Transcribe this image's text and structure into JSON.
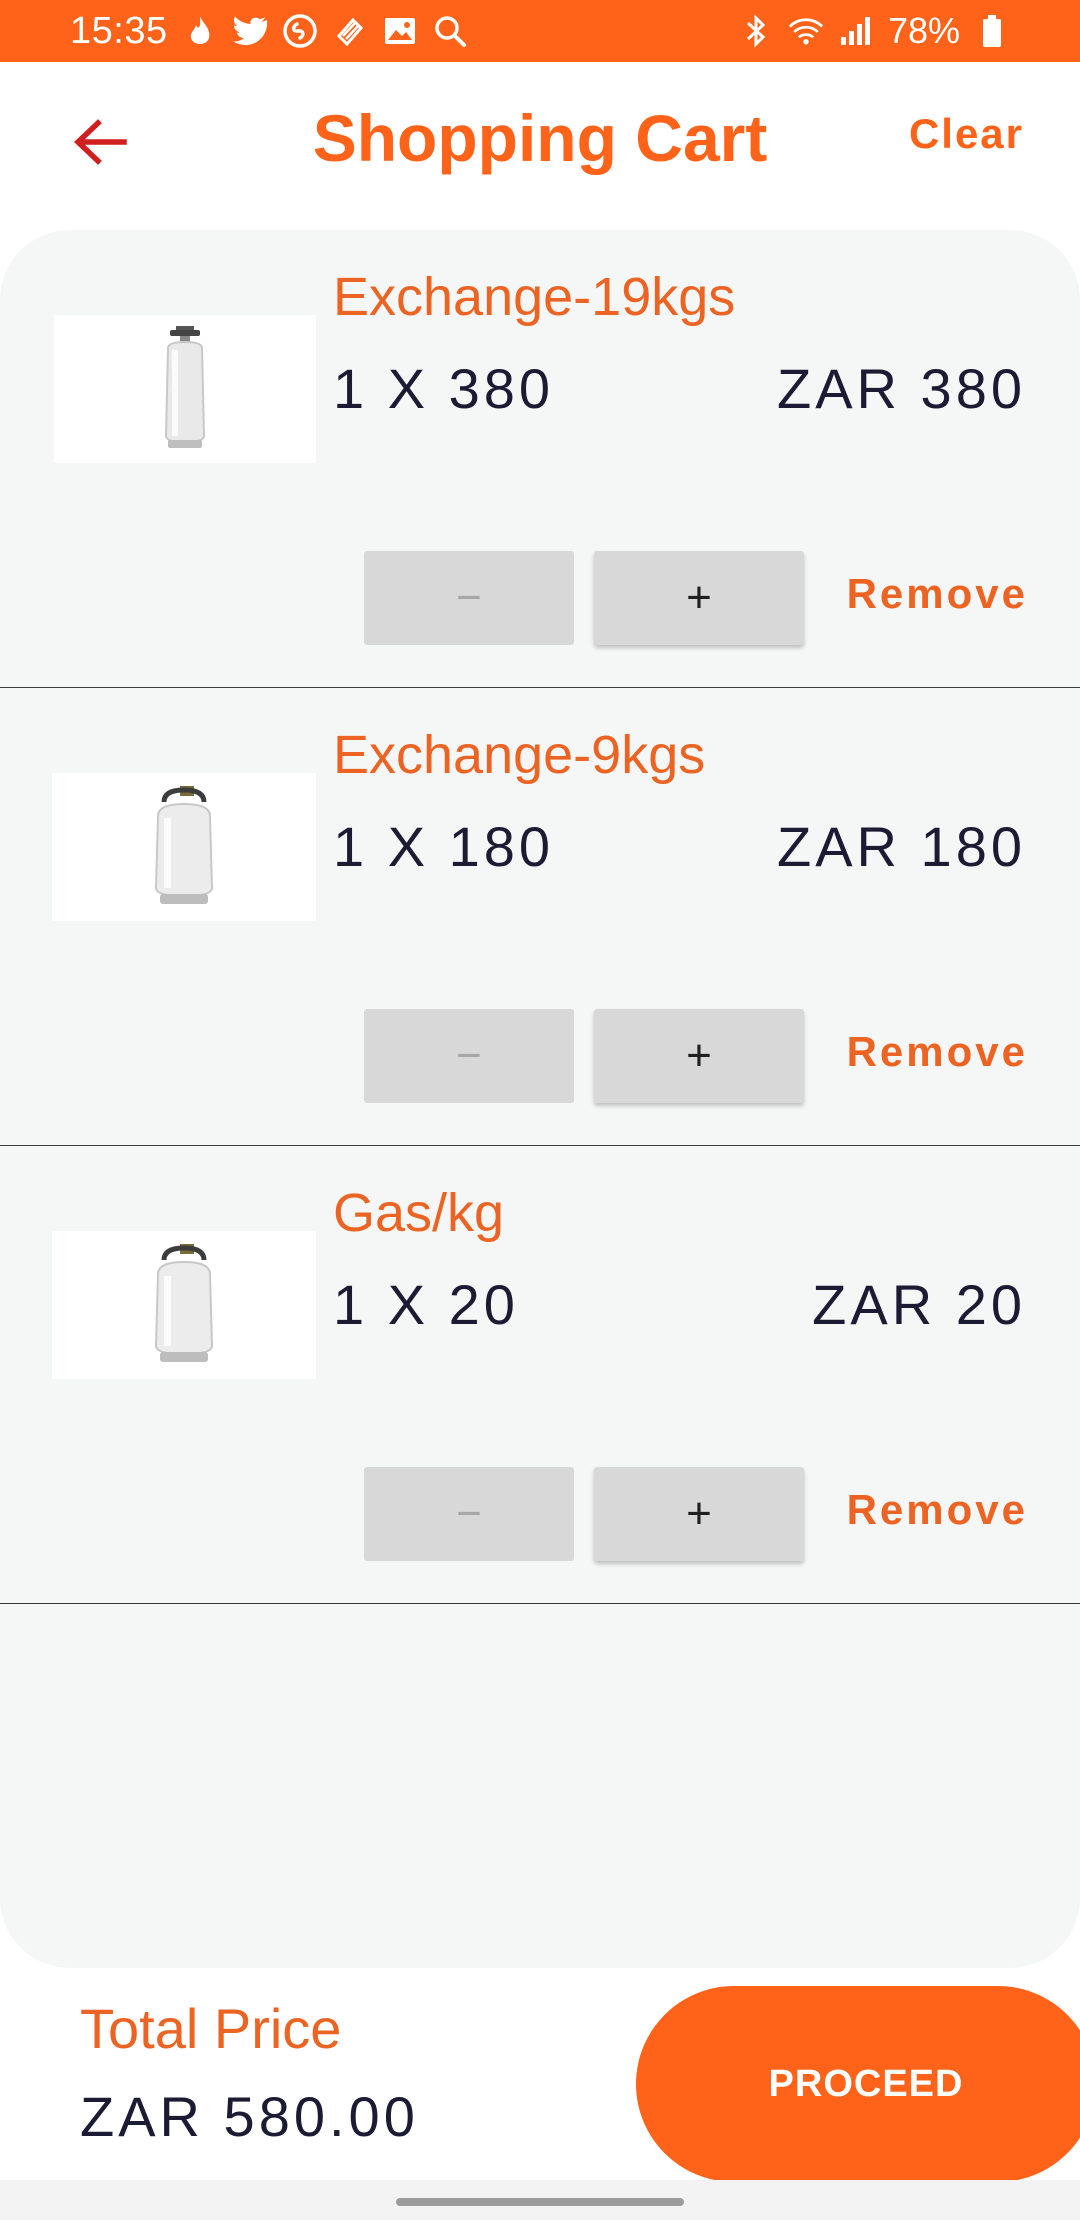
{
  "status_bar": {
    "time": "15:35",
    "battery": "78%",
    "left_icons": [
      "flame-icon",
      "twitter-icon",
      "shazam-icon",
      "pay-icon",
      "gallery-icon",
      "search-icon"
    ],
    "right_icons": [
      "bluetooth-icon",
      "wifi-icon",
      "signal-icon",
      "battery-icon"
    ],
    "background": "#ff6319"
  },
  "header": {
    "title": "Shopping Cart",
    "clear_label": "Clear",
    "back_icon": "arrow-left-icon",
    "accent": "#ff6319",
    "back_color": "#d11f1f"
  },
  "cart": {
    "items": [
      {
        "name": "Exchange-19kgs",
        "quantity_line": "1 X 380",
        "line_total": "ZAR 380",
        "minus_label": "−",
        "plus_label": "+",
        "remove_label": "Remove",
        "image_icon": "gas-cylinder-19kg-icon"
      },
      {
        "name": "Exchange-9kgs",
        "quantity_line": "1 X 180",
        "line_total": "ZAR 180",
        "minus_label": "−",
        "plus_label": "+",
        "remove_label": "Remove",
        "image_icon": "gas-cylinder-9kg-icon"
      },
      {
        "name": "Gas/kg",
        "quantity_line": "1 X 20",
        "line_total": "ZAR 20",
        "minus_label": "−",
        "plus_label": "+",
        "remove_label": "Remove",
        "image_icon": "gas-cylinder-icon"
      }
    ]
  },
  "footer": {
    "total_label": "Total Price",
    "total_value": "ZAR 580.00",
    "proceed_label": "PROCEED"
  }
}
